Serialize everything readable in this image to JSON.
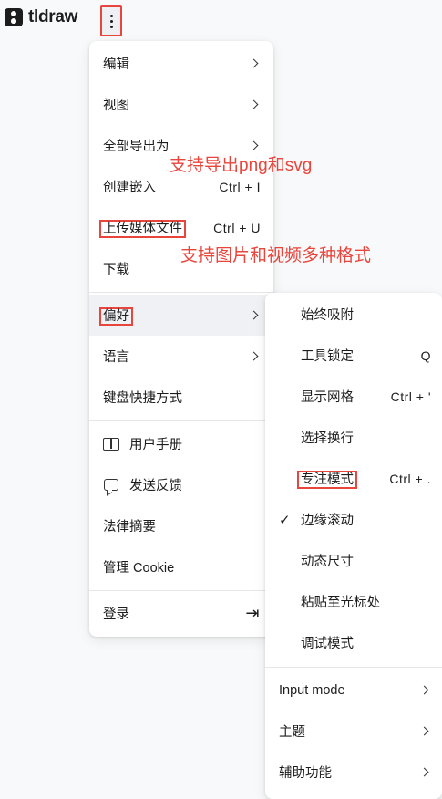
{
  "app": {
    "name": "tldraw"
  },
  "main_menu": {
    "items": [
      {
        "label": "编辑",
        "submenu": true
      },
      {
        "label": "视图",
        "submenu": true
      },
      {
        "label": "全部导出为",
        "submenu": true
      },
      {
        "label": "创建嵌入",
        "shortcut": "Ctrl +  I"
      },
      {
        "label": "上传媒体文件",
        "shortcut": "Ctrl + U"
      },
      {
        "label": "下载"
      },
      {
        "label": "偏好",
        "submenu": true
      },
      {
        "label": "语言",
        "submenu": true
      },
      {
        "label": "键盘快捷方式"
      },
      {
        "label": "用户手册",
        "icon": "book-icon"
      },
      {
        "label": "发送反馈",
        "icon": "chat-icon"
      },
      {
        "label": "法律摘要"
      },
      {
        "label": "管理 Cookie"
      },
      {
        "label": "登录",
        "icon": "login-icon"
      }
    ]
  },
  "preferences_menu": {
    "items": [
      {
        "label": "始终吸附"
      },
      {
        "label": "工具锁定",
        "shortcut": "Q"
      },
      {
        "label": "显示网格",
        "shortcut": "Ctrl +  '"
      },
      {
        "label": "选择换行"
      },
      {
        "label": "专注模式",
        "shortcut": "Ctrl +  ."
      },
      {
        "label": "边缘滚动",
        "checked": true,
        "check_glyph": "✓"
      },
      {
        "label": "动态尺寸"
      },
      {
        "label": "粘贴至光标处"
      },
      {
        "label": "调试模式"
      },
      {
        "label": "Input mode",
        "submenu": true
      },
      {
        "label": "主题",
        "submenu": true
      },
      {
        "label": "辅助功能",
        "submenu": true
      }
    ]
  },
  "annotations": {
    "export": "支持导出png和svg",
    "upload": "支持图片和视频多种格式"
  },
  "colors": {
    "annotation": "#e8453c",
    "highlight": "#f0f1f4"
  }
}
